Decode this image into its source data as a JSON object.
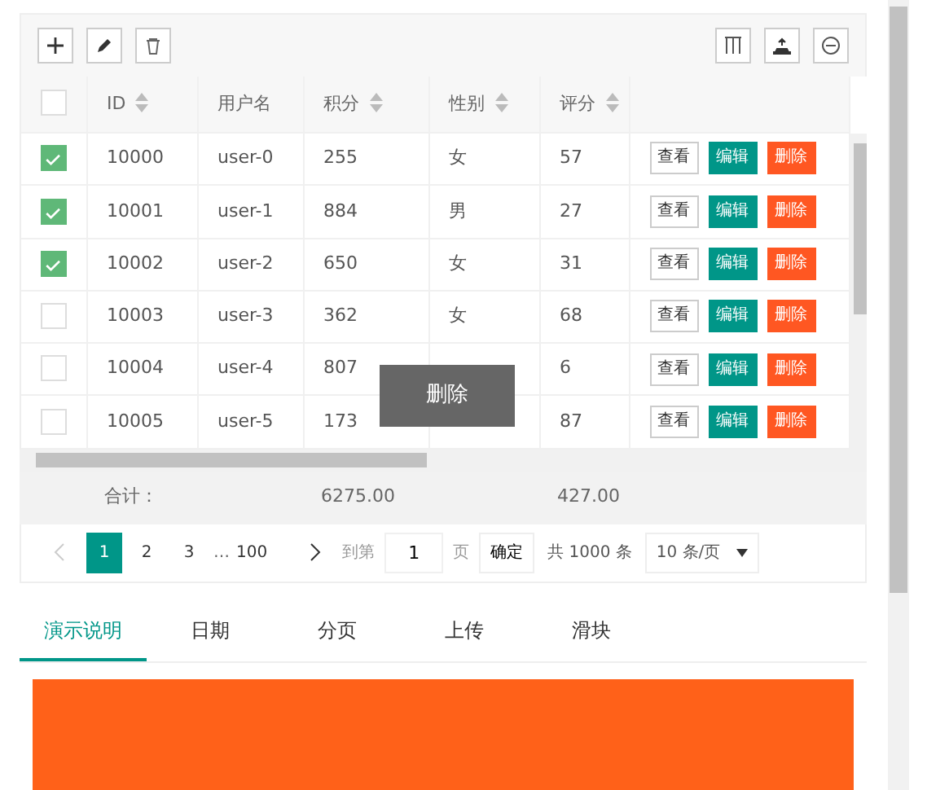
{
  "toolbar": {
    "left": [
      {
        "kind": "add"
      },
      {
        "kind": "edit"
      },
      {
        "kind": "delete"
      }
    ],
    "right": [
      {
        "kind": "columns"
      },
      {
        "kind": "export"
      },
      {
        "kind": "print"
      }
    ]
  },
  "table": {
    "header_checked": false,
    "columns": [
      {
        "label": "ID",
        "sortable": true
      },
      {
        "label": "用户名",
        "sortable": false
      },
      {
        "label": "积分",
        "sortable": true
      },
      {
        "label": "性别",
        "sortable": true
      },
      {
        "label": "评分",
        "sortable": true
      }
    ],
    "rows": [
      {
        "checked": true,
        "cells": [
          "10000",
          "user-0",
          "255",
          "女",
          "57"
        ],
        "actions": [
          "查看",
          "编辑",
          "删除"
        ]
      },
      {
        "checked": true,
        "cells": [
          "10001",
          "user-1",
          "884",
          "男",
          "27"
        ],
        "actions": [
          "查看",
          "编辑",
          "删除"
        ]
      },
      {
        "checked": true,
        "cells": [
          "10002",
          "user-2",
          "650",
          "女",
          "31"
        ],
        "actions": [
          "查看",
          "编辑",
          "删除"
        ]
      },
      {
        "checked": false,
        "cells": [
          "10003",
          "user-3",
          "362",
          "女",
          "68"
        ],
        "actions": [
          "查看",
          "编辑",
          "删除"
        ]
      },
      {
        "checked": false,
        "cells": [
          "10004",
          "user-4",
          "807",
          null,
          "6"
        ],
        "actions": [
          "查看",
          "编辑",
          "删除"
        ]
      },
      {
        "checked": false,
        "cells": [
          "10005",
          "user-5",
          "173",
          null,
          "87"
        ],
        "actions": [
          "查看",
          "编辑",
          "删除"
        ]
      }
    ],
    "tooltip": "删除",
    "totals": {
      "label": "合计：",
      "score": "6275.00",
      "rating": "427.00"
    }
  },
  "pagination": {
    "prev_disabled": true,
    "pages": [
      {
        "label": "1",
        "selected": true
      },
      {
        "label": "2",
        "selected": false
      },
      {
        "label": "3",
        "selected": false
      },
      {
        "label": "…",
        "kind": "ellipsis"
      },
      {
        "label": "100",
        "selected": false
      }
    ],
    "goto_label": "到第",
    "goto_value": "1",
    "page_unit": "页",
    "confirm": "确定",
    "total": "共 1000 条",
    "page_size": "10 条/页"
  },
  "tabs": [
    {
      "label": "演示说明",
      "selected": true
    },
    {
      "label": "日期",
      "selected": false
    },
    {
      "label": "分页",
      "selected": false
    },
    {
      "label": "上传",
      "selected": false
    },
    {
      "label": "滑块",
      "selected": false
    }
  ]
}
